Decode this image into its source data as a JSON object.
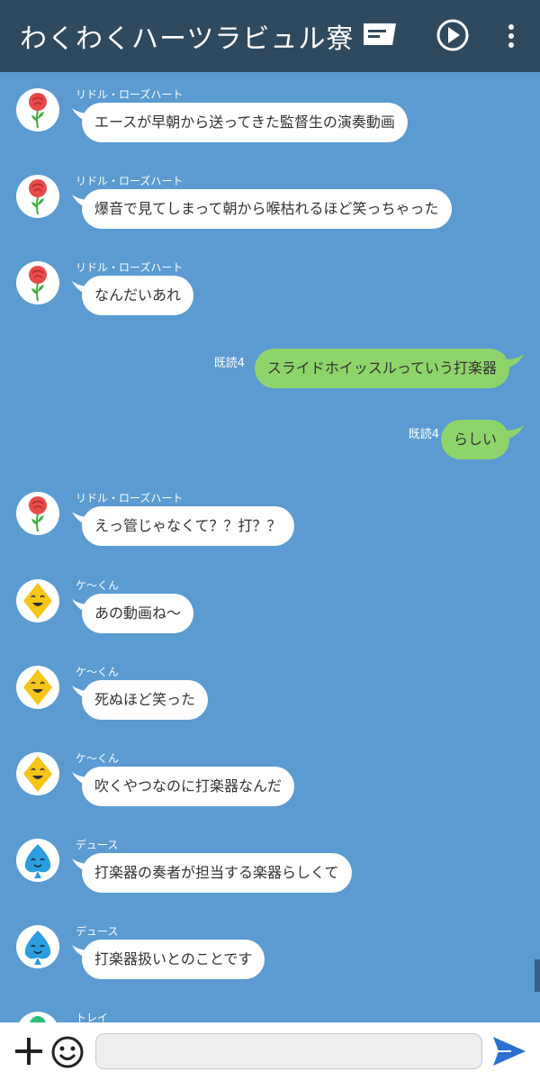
{
  "header": {
    "title": "わくわくハーツラビュル寮",
    "icons": [
      "message-icon",
      "play-icon",
      "more-icon"
    ]
  },
  "messages": [
    {
      "side": "left",
      "sender": "リドル・ローズハート",
      "avatar": "rose-icon",
      "text": "エースが早朝から送ってきた監督生の演奏動画"
    },
    {
      "side": "left",
      "sender": "リドル・ローズハート",
      "avatar": "rose-icon",
      "text": "爆音で見てしまって朝から喉枯れるほど笑っちゃった"
    },
    {
      "side": "left",
      "sender": "リドル・ローズハート",
      "avatar": "rose-icon",
      "text": "なんだいあれ"
    },
    {
      "side": "right",
      "read": "既読4",
      "text": "スライドホイッスルっていう打楽器"
    },
    {
      "side": "right",
      "read": "既読4",
      "text": "らしい"
    },
    {
      "side": "left",
      "sender": "リドル・ローズハート",
      "avatar": "rose-icon",
      "text": "えっ管じゃなくて？？打？？"
    },
    {
      "side": "left",
      "sender": "ケ〜くん",
      "avatar": "diamond-face-icon",
      "text": "あの動画ね〜"
    },
    {
      "side": "left",
      "sender": "ケ〜くん",
      "avatar": "diamond-face-icon",
      "text": "死ぬほど笑った"
    },
    {
      "side": "left",
      "sender": "ケ〜くん",
      "avatar": "diamond-face-icon",
      "text": "吹くやつなのに打楽器なんだ"
    },
    {
      "side": "left",
      "sender": "デュース",
      "avatar": "spade-face-icon",
      "text": "打楽器の奏者が担当する楽器らしくて"
    },
    {
      "side": "left",
      "sender": "デュース",
      "avatar": "spade-face-icon",
      "text": "打楽器扱いとのことです"
    },
    {
      "side": "left",
      "sender": "トレイ",
      "avatar": "clover-icon",
      "text": ""
    }
  ],
  "input": {
    "placeholder": "",
    "icons": [
      "plus-icon",
      "emoji-icon",
      "send-icon"
    ]
  },
  "colors": {
    "header_bg": "#2f4a5e",
    "chat_bg": "#5b9bd1",
    "bubble_left": "#ffffff",
    "bubble_right": "#8fd46a",
    "send": "#2c6fd1"
  }
}
